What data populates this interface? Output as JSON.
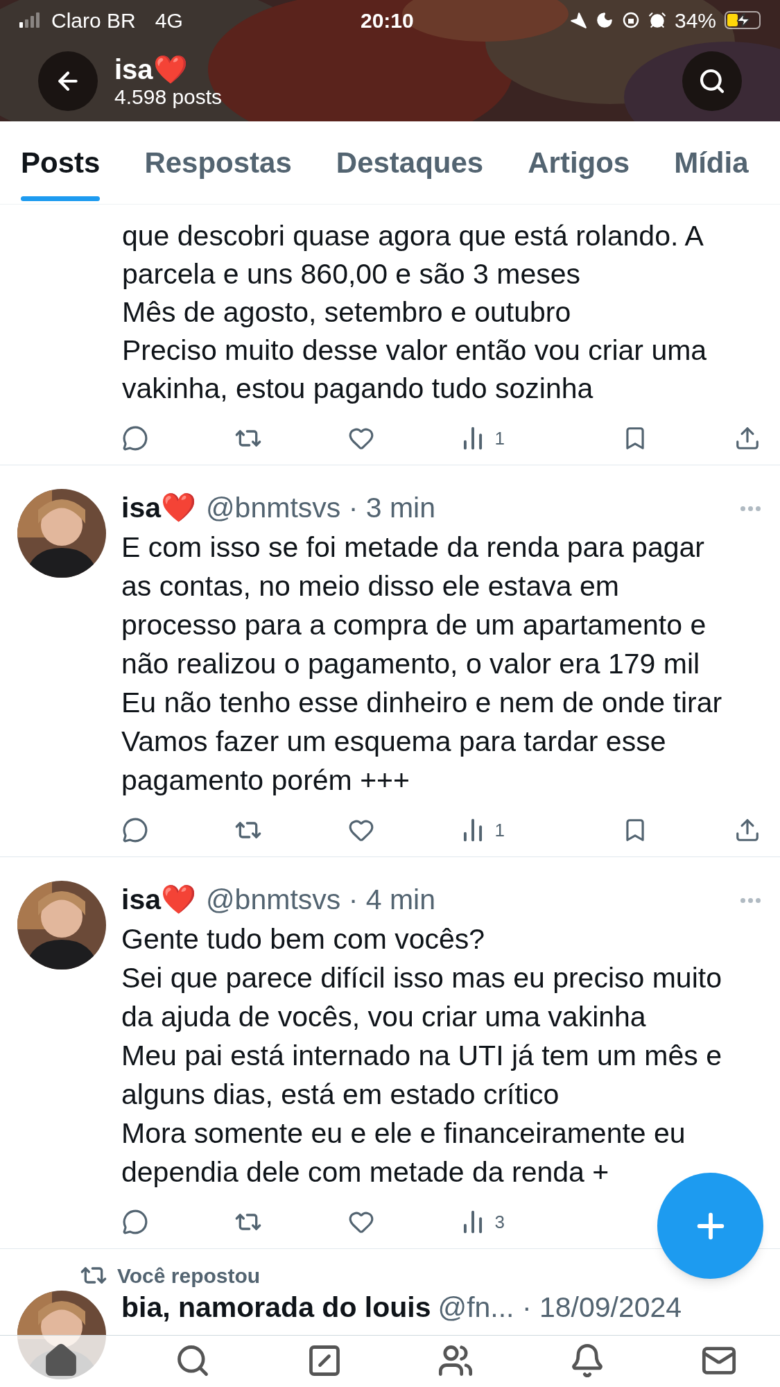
{
  "status_bar": {
    "carrier": "Claro BR",
    "network": "4G",
    "time": "20:10",
    "battery": "34%",
    "charging": true
  },
  "header": {
    "title": "isa❤️",
    "subtitle": "4.598 posts"
  },
  "tabs": [
    {
      "label": "Posts",
      "selected": true
    },
    {
      "label": "Respostas",
      "selected": false
    },
    {
      "label": "Destaques",
      "selected": false
    },
    {
      "label": "Artigos",
      "selected": false
    },
    {
      "label": "Mídia",
      "selected": false
    }
  ],
  "posts": [
    {
      "kind": "continued",
      "text": "que descobri quase agora que está rolando. A\nparcela e uns 860,00 e são 3 meses\nMês de agosto, setembro e outubro\nPreciso muito desse valor então vou criar uma\nvakinha, estou pagando tudo sozinha",
      "views": "1"
    },
    {
      "kind": "full",
      "name": "isa❤️",
      "meta": "@bnmtsvs · 3 min",
      "text": "E com isso se foi metade da renda para pagar\nas contas, no meio disso ele estava em\nprocesso para a compra de um apartamento e\nnão realizou o pagamento, o valor era 179 mil\nEu não tenho esse dinheiro e nem de onde tirar\nVamos fazer um esquema para tardar esse\npagamento porém +++",
      "views": "1"
    },
    {
      "kind": "covered",
      "name": "isa❤️",
      "meta": "@bnmtsvs · 4 min",
      "text": "Gente tudo bem com vocês?\nSei que parece difícil isso mas eu preciso muito\nda ajuda de vocês, vou criar uma vakinha\nMeu pai está internado na UTI já tem um mês e\nalguns dias, está em estado crítico\nMora somente eu e ele e financeiramente eu\ndependia dele com metade da renda +",
      "views": "3"
    }
  ],
  "repost": {
    "label": "Você repostou",
    "name": "bia, namorada do louis",
    "meta": "@fn... · 18/09/2024"
  },
  "bottom_nav": [
    {
      "kind": "home",
      "selected": true
    },
    {
      "kind": "search",
      "selected": false
    },
    {
      "kind": "grok",
      "selected": false
    },
    {
      "kind": "communities",
      "selected": false
    },
    {
      "kind": "notifications",
      "selected": false
    },
    {
      "kind": "messages",
      "selected": false
    }
  ]
}
